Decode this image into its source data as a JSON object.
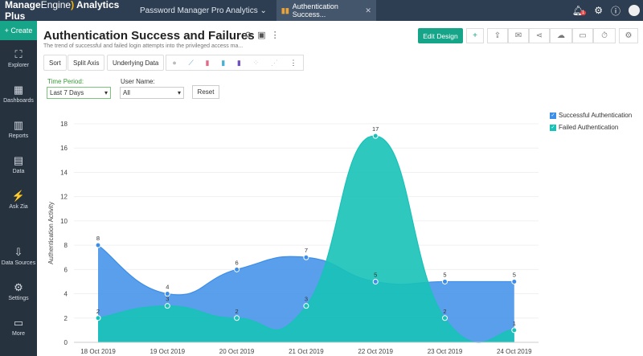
{
  "topbar": {
    "brand_a": "Manage",
    "brand_b": "Engine",
    "brand_c": "Analytics Plus",
    "workspace": "Password Manager Pro Analytics ⌄",
    "tab": "Authentication Success...",
    "notif_count": "1"
  },
  "sidebar": {
    "create": "+ Create",
    "items": [
      {
        "label": "Explorer",
        "icon": "⛶"
      },
      {
        "label": "Dashboards",
        "icon": "▦"
      },
      {
        "label": "Reports",
        "icon": "▥"
      },
      {
        "label": "Data",
        "icon": "▤"
      },
      {
        "label": "Ask Zia",
        "icon": "⚡"
      },
      {
        "label": "Data Sources",
        "icon": "⇩"
      },
      {
        "label": "Settings",
        "icon": "⚙"
      },
      {
        "label": "More",
        "icon": "▭"
      }
    ]
  },
  "report": {
    "title": "Authentication Success and Failures",
    "subtitle": "The trend of successful and failed login attempts into the privileged access ma..."
  },
  "toolbar": {
    "sort": "Sort",
    "split_axis": "Split Axis",
    "underlying_data": "Underlying Data",
    "edit_design": "Edit Design"
  },
  "filters": {
    "time_label": "Time Period:",
    "time_value": "Last 7 Days",
    "user_label": "User Name:",
    "user_value": "All",
    "reset": "Reset"
  },
  "colors": {
    "success": "#3d8ee8",
    "failed": "#18c2b8",
    "accent": "#17a589"
  },
  "chart_data": {
    "type": "area",
    "categories": [
      "18 Oct 2019",
      "19 Oct 2019",
      "20 Oct 2019",
      "21 Oct 2019",
      "22 Oct 2019",
      "23 Oct 2019",
      "24 Oct 2019"
    ],
    "ylabel": "Authentication Activity",
    "ylim": [
      0,
      18
    ],
    "yticks": [
      0,
      2,
      4,
      6,
      8,
      10,
      12,
      14,
      16,
      18
    ],
    "legend": "top-right",
    "series": [
      {
        "name": "Successful Authentication",
        "values": [
          8,
          4,
          6,
          7,
          5,
          5,
          5
        ]
      },
      {
        "name": "Failed Authentication",
        "values": [
          2,
          3,
          2,
          3,
          17,
          2,
          1
        ]
      }
    ]
  }
}
